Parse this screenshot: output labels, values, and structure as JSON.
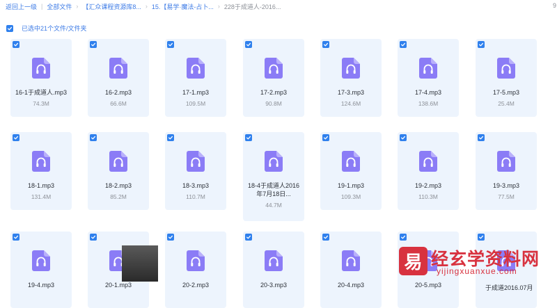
{
  "breadcrumb": {
    "back": "返回上一级",
    "items": [
      "全部文件",
      "【汇众课程资源库8...",
      "15.【易学·魔法-占卜...",
      "228于成道人-2016..."
    ],
    "edge_char": "9"
  },
  "selection": {
    "label": "已选中21个文件/文件夹"
  },
  "files": [
    {
      "name": "16-1于成道人.mp3",
      "size": "74.3M"
    },
    {
      "name": "16-2.mp3",
      "size": "66.6M"
    },
    {
      "name": "17-1.mp3",
      "size": "109.5M"
    },
    {
      "name": "17-2.mp3",
      "size": "90.8M"
    },
    {
      "name": "17-3.mp3",
      "size": "124.6M"
    },
    {
      "name": "17-4.mp3",
      "size": "138.6M"
    },
    {
      "name": "17-5.mp3",
      "size": "25.4M"
    },
    {
      "name": "18-1.mp3",
      "size": "131.4M"
    },
    {
      "name": "18-2.mp3",
      "size": "85.2M"
    },
    {
      "name": "18-3.mp3",
      "size": "110.7M"
    },
    {
      "name": "18-4于成道人2016年7月18日...",
      "size": "44.7M"
    },
    {
      "name": "19-1.mp3",
      "size": "109.3M"
    },
    {
      "name": "19-2.mp3",
      "size": "110.3M"
    },
    {
      "name": "19-3.mp3",
      "size": "77.5M"
    },
    {
      "name": "19-4.mp3",
      "size": ""
    },
    {
      "name": "20-1.mp3",
      "size": ""
    },
    {
      "name": "20-2.mp3",
      "size": ""
    },
    {
      "name": "20-3.mp3",
      "size": ""
    },
    {
      "name": "20-4.mp3",
      "size": ""
    },
    {
      "name": "20-5.mp3",
      "size": ""
    },
    {
      "name": "",
      "size": ""
    }
  ],
  "overlay_filename": "于成道2016.07月",
  "watermark": {
    "title": "经玄学资料网",
    "url": "yijingxuanxue.com",
    "logo_char": "易"
  },
  "icons": {
    "check": "check-icon",
    "audio": "audio-file-icon"
  },
  "colors": {
    "accent": "#2f80ed",
    "card": "#edf4fd",
    "icon": "#8b7cf6",
    "watermark": "#d8323f"
  }
}
